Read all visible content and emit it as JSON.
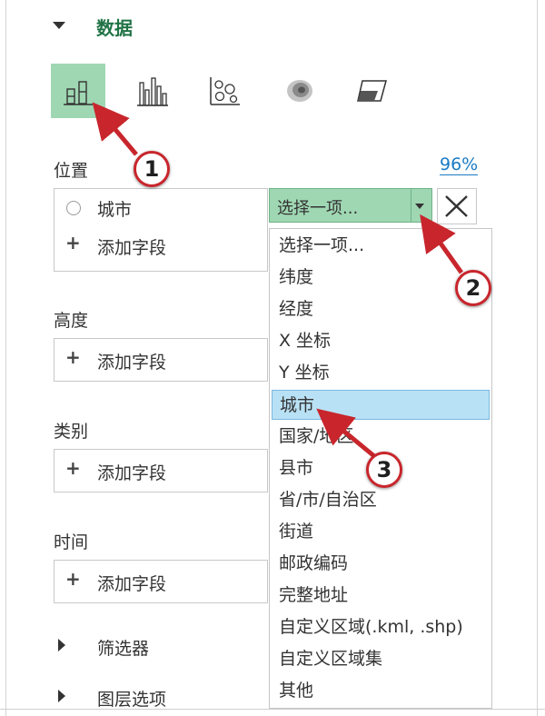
{
  "section": {
    "title": "数据"
  },
  "fields": {
    "location": {
      "label": "位置",
      "percent": "96%",
      "city_field": "城市",
      "add_field": "添加字段"
    },
    "height": {
      "label": "高度",
      "add_field": "添加字段"
    },
    "category": {
      "label": "类别",
      "add_field": "添加字段"
    },
    "time": {
      "label": "时间",
      "add_field": "添加字段"
    }
  },
  "geo_select": {
    "selected_value": "选择一项..."
  },
  "dropdown": {
    "items": [
      "选择一项...",
      "纬度",
      "经度",
      "X 坐标",
      "Y 坐标",
      "城市",
      "国家/地区",
      "县市",
      "省/市/自治区",
      "街道",
      "邮政编码",
      "完整地址",
      "自定义区域(.kml, .shp)",
      "自定义区域集",
      "其他"
    ],
    "highlighted_item": "城市"
  },
  "collapsed_sections": {
    "filters": "筛选器",
    "layer_options": "图层选项"
  },
  "callouts": [
    "1",
    "2",
    "3"
  ],
  "icons": {
    "viz_types": [
      "stacked-column-icon",
      "clustered-column-icon",
      "bubble-icon",
      "heat-map-icon",
      "region-icon"
    ]
  },
  "colors": {
    "accent_green": "#217346",
    "active_bg": "#9fd7b3",
    "link_blue": "#1a7bc4",
    "highlight_blue": "#b9e1f5",
    "callout_red": "#c8262c"
  }
}
